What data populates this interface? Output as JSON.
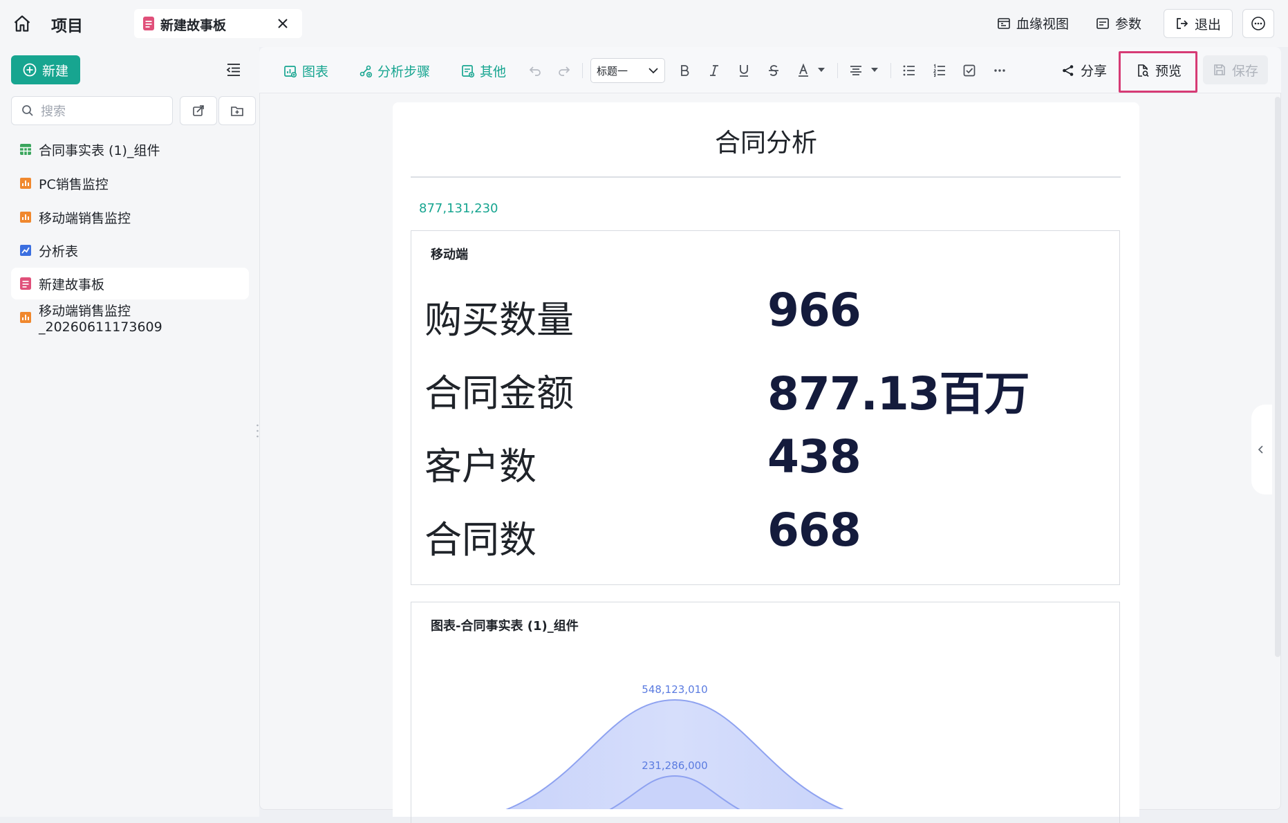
{
  "header": {
    "home_icon": "home-icon",
    "title": "项目",
    "tab_label": "新建故事板",
    "actions": {
      "lineage": "血缘视图",
      "params": "参数",
      "logout": "退出"
    }
  },
  "sidebar": {
    "new_label": "新建",
    "search_placeholder": "搜索",
    "items": [
      {
        "label": "合同事实表 (1)_组件",
        "icon": "table-icon",
        "color": "#3aa55d"
      },
      {
        "label": "PC销售监控",
        "icon": "dashboard-icon",
        "color": "#f0882e"
      },
      {
        "label": "移动端销售监控",
        "icon": "dashboard-icon",
        "color": "#f0882e"
      },
      {
        "label": "分析表",
        "icon": "analysis-icon",
        "color": "#3b6fe0"
      },
      {
        "label": "新建故事板",
        "icon": "storyboard-icon",
        "color": "#e0507a",
        "active": true
      },
      {
        "label": "移动端销售监控_20260611173609",
        "icon": "dashboard-icon",
        "color": "#f0882e"
      }
    ]
  },
  "toolbar": {
    "chart": "图表",
    "analysis_steps": "分析步骤",
    "other": "其他",
    "heading_select": "标题一",
    "share": "分享",
    "preview": "预览",
    "save": "保存"
  },
  "document": {
    "title": "合同分析",
    "top_value": "877,131,230",
    "kpi_card": {
      "title": "移动端",
      "rows": [
        {
          "label": "购买数量",
          "value": "966"
        },
        {
          "label": "合同金额",
          "value": "877.13百万"
        },
        {
          "label": "客户数",
          "value": "438"
        },
        {
          "label": "合同数",
          "value": "668"
        }
      ]
    },
    "chart_card": {
      "title": "图表-合同事实表 (1)_组件"
    }
  },
  "chart_data": {
    "type": "area",
    "title": "图表-合同事实表 (1)_组件",
    "series": [
      {
        "values": [
          548123010
        ]
      },
      {
        "values": [
          231286000
        ]
      }
    ],
    "data_labels": [
      "548,123,010",
      "231,286,000"
    ],
    "color": "#8ea2f0"
  },
  "colors": {
    "accent": "#17a590",
    "preview_highlight": "#d63b75",
    "kpi_value": "#141b3c"
  }
}
